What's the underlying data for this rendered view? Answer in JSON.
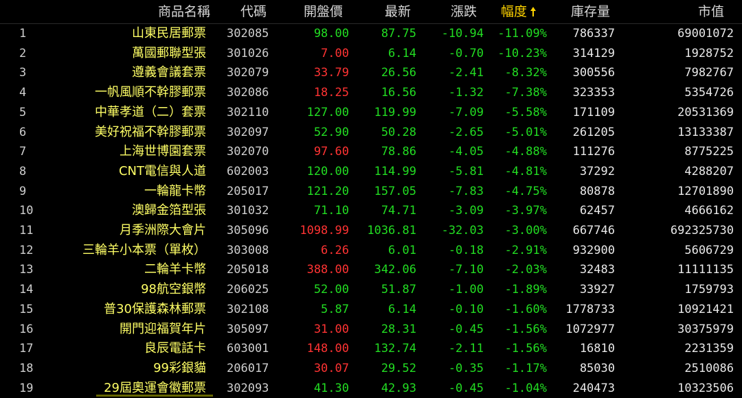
{
  "headers": {
    "name": "商品名稱",
    "code": "代碼",
    "open": "開盤價",
    "latest": "最新",
    "change": "漲跌",
    "pct": "幅度",
    "stock": "庫存量",
    "mktcap": "市值",
    "sort_icon": "up-arrow-icon"
  },
  "colors": {
    "up": "#ff3333",
    "down": "#22dd22",
    "name": "#ffff66",
    "header_sorted": "#ffd400"
  },
  "rows": [
    {
      "idx": "1",
      "name": "山東民居郵票",
      "code": "302085",
      "open": "98.00",
      "open_dir": "down",
      "latest": "87.75",
      "change": "-10.94",
      "pct": "-11.09%",
      "stock": "786337",
      "mktcap": "69001072"
    },
    {
      "idx": "2",
      "name": "萬國郵聯型張",
      "code": "301026",
      "open": "7.00",
      "open_dir": "up",
      "latest": "6.14",
      "change": "-0.70",
      "pct": "-10.23%",
      "stock": "314129",
      "mktcap": "1928752"
    },
    {
      "idx": "3",
      "name": "遵義會議套票",
      "code": "302079",
      "open": "33.79",
      "open_dir": "up",
      "latest": "26.56",
      "change": "-2.41",
      "pct": "-8.32%",
      "stock": "300556",
      "mktcap": "7982767"
    },
    {
      "idx": "4",
      "name": "一帆風順不幹膠郵票",
      "code": "302086",
      "open": "18.25",
      "open_dir": "up",
      "latest": "16.56",
      "change": "-1.32",
      "pct": "-7.38%",
      "stock": "323353",
      "mktcap": "5354726"
    },
    {
      "idx": "5",
      "name": "中華孝道（二）套票",
      "code": "302110",
      "open": "127.00",
      "open_dir": "down",
      "latest": "119.99",
      "change": "-7.09",
      "pct": "-5.58%",
      "stock": "171109",
      "mktcap": "20531369"
    },
    {
      "idx": "6",
      "name": "美好祝福不幹膠郵票",
      "code": "302097",
      "open": "52.90",
      "open_dir": "down",
      "latest": "50.28",
      "change": "-2.65",
      "pct": "-5.01%",
      "stock": "261205",
      "mktcap": "13133387"
    },
    {
      "idx": "7",
      "name": "上海世博園套票",
      "code": "302070",
      "open": "97.60",
      "open_dir": "up",
      "latest": "78.86",
      "change": "-4.05",
      "pct": "-4.88%",
      "stock": "111276",
      "mktcap": "8775225"
    },
    {
      "idx": "8",
      "name": "CNT電信與人道",
      "code": "602003",
      "open": "120.00",
      "open_dir": "down",
      "latest": "114.99",
      "change": "-5.81",
      "pct": "-4.81%",
      "stock": "37292",
      "mktcap": "4288207"
    },
    {
      "idx": "9",
      "name": "一輪龍卡幣",
      "code": "205017",
      "open": "121.20",
      "open_dir": "down",
      "latest": "157.05",
      "change": "-7.83",
      "pct": "-4.75%",
      "stock": "80878",
      "mktcap": "12701890"
    },
    {
      "idx": "10",
      "name": "澳歸金箔型張",
      "code": "301032",
      "open": "71.10",
      "open_dir": "down",
      "latest": "74.71",
      "change": "-3.09",
      "pct": "-3.97%",
      "stock": "62457",
      "mktcap": "4666162"
    },
    {
      "idx": "11",
      "name": "月季洲際大會片",
      "code": "305096",
      "open": "1098.99",
      "open_dir": "up",
      "latest": "1036.81",
      "change": "-32.03",
      "pct": "-3.00%",
      "stock": "667746",
      "mktcap": "692325730"
    },
    {
      "idx": "12",
      "name": "三輪羊小本票（單枚）",
      "code": "303008",
      "open": "6.26",
      "open_dir": "up",
      "latest": "6.01",
      "change": "-0.18",
      "pct": "-2.91%",
      "stock": "932900",
      "mktcap": "5606729"
    },
    {
      "idx": "13",
      "name": "二輪羊卡幣",
      "code": "205018",
      "open": "388.00",
      "open_dir": "up",
      "latest": "342.06",
      "change": "-7.10",
      "pct": "-2.03%",
      "stock": "32483",
      "mktcap": "11111135"
    },
    {
      "idx": "14",
      "name": "98航空銀幣",
      "code": "206025",
      "open": "52.00",
      "open_dir": "down",
      "latest": "51.87",
      "change": "-1.00",
      "pct": "-1.89%",
      "stock": "33927",
      "mktcap": "1759793"
    },
    {
      "idx": "15",
      "name": "普30保護森林郵票",
      "code": "302108",
      "open": "5.87",
      "open_dir": "down",
      "latest": "6.14",
      "change": "-0.10",
      "pct": "-1.60%",
      "stock": "1778733",
      "mktcap": "10921421"
    },
    {
      "idx": "16",
      "name": "開門迎福賀年片",
      "code": "305097",
      "open": "31.00",
      "open_dir": "up",
      "latest": "28.31",
      "change": "-0.45",
      "pct": "-1.56%",
      "stock": "1072977",
      "mktcap": "30375979"
    },
    {
      "idx": "17",
      "name": "良辰電話卡",
      "code": "603001",
      "open": "148.00",
      "open_dir": "up",
      "latest": "132.74",
      "change": "-2.11",
      "pct": "-1.56%",
      "stock": "16810",
      "mktcap": "2231359"
    },
    {
      "idx": "18",
      "name": "99彩銀貓",
      "code": "206017",
      "open": "30.07",
      "open_dir": "up",
      "latest": "29.52",
      "change": "-0.35",
      "pct": "-1.17%",
      "stock": "85030",
      "mktcap": "2510086"
    },
    {
      "idx": "19",
      "name": "29屆奧運會徽郵票",
      "code": "302093",
      "open": "41.30",
      "open_dir": "down",
      "latest": "42.93",
      "change": "-0.45",
      "pct": "-1.04%",
      "stock": "240473",
      "mktcap": "10323506"
    }
  ]
}
